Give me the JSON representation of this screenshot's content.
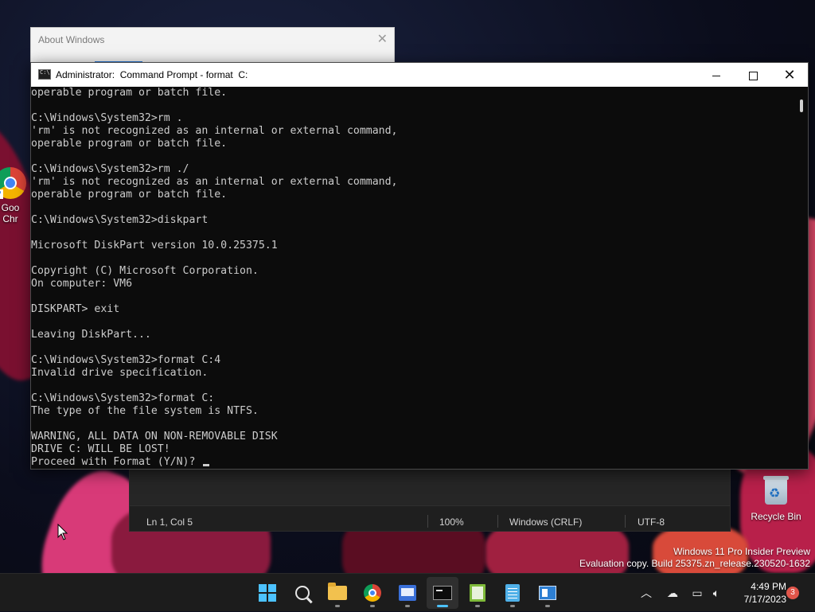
{
  "desktop": {
    "icons": [
      {
        "label": "Goo\nChr"
      },
      {
        "label": "Recycle Bin"
      }
    ],
    "watermark": {
      "line1": "Windows 11 Pro Insider Preview",
      "line2": "Evaluation copy. Build 25375.zn_release.230520-1632"
    }
  },
  "about_window": {
    "title": "About Windows"
  },
  "notepad": {
    "status": {
      "position": "Ln 1, Col 5",
      "zoom": "100%",
      "line_ending": "Windows (CRLF)",
      "encoding": "UTF-8"
    }
  },
  "cmd": {
    "title": "Administrator:  Command Prompt - format  C:",
    "lines": [
      "operable program or batch file.",
      "",
      "C:\\Windows\\System32>rm .",
      "'rm' is not recognized as an internal or external command,",
      "operable program or batch file.",
      "",
      "C:\\Windows\\System32>rm ./",
      "'rm' is not recognized as an internal or external command,",
      "operable program or batch file.",
      "",
      "C:\\Windows\\System32>diskpart",
      "",
      "Microsoft DiskPart version 10.0.25375.1",
      "",
      "Copyright (C) Microsoft Corporation.",
      "On computer: VM6",
      "",
      "DISKPART> exit",
      "",
      "Leaving DiskPart...",
      "",
      "C:\\Windows\\System32>format C:4",
      "Invalid drive specification.",
      "",
      "C:\\Windows\\System32>format C:",
      "The type of the file system is NTFS.",
      "",
      "WARNING, ALL DATA ON NON-REMOVABLE DISK",
      "DRIVE C: WILL BE LOST!",
      "Proceed with Format (Y/N)? "
    ]
  },
  "taskbar": {
    "icons": [
      "windows-start-icon",
      "search-icon",
      "file-explorer-icon",
      "chrome-icon",
      "remote-desktop-icon",
      "command-prompt-icon",
      "task-manager-icon",
      "notepad-icon",
      "system-info-icon"
    ],
    "active": "command-prompt-icon",
    "tray": {
      "time": "4:49 PM",
      "date": "7/17/2023",
      "notifications": "3"
    }
  },
  "colors": {
    "accent": "#4cc2ff",
    "console_bg": "#0c0c0c",
    "console_text": "#cccccc",
    "badge": "#e0554a"
  }
}
